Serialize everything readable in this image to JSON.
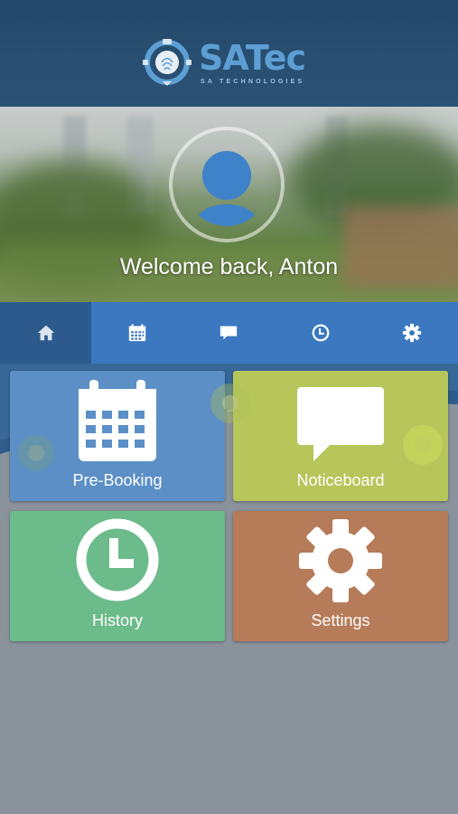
{
  "header": {
    "brand": "SATec",
    "tagline": "SA TECHNOLOGIES",
    "colors": {
      "header_bg": "#24496a",
      "brand_blue": "#5d9fd4"
    }
  },
  "hero": {
    "welcome_text": "Welcome back, Anton",
    "avatar_icon": "user-avatar-icon"
  },
  "tabs": [
    {
      "id": "home",
      "icon": "home-icon",
      "active": true
    },
    {
      "id": "pre-booking",
      "icon": "calendar-icon",
      "active": false
    },
    {
      "id": "noticeboard",
      "icon": "chat-bubble-icon",
      "active": false
    },
    {
      "id": "history",
      "icon": "clock-icon",
      "active": false
    },
    {
      "id": "settings",
      "icon": "gear-icon",
      "active": false
    }
  ],
  "tiles": [
    {
      "label": "Pre-Booking",
      "icon": "calendar-icon",
      "color": "#5b8fc6"
    },
    {
      "label": "Noticeboard",
      "icon": "chat-bubble-icon",
      "color": "#b6c65a"
    },
    {
      "label": "History",
      "icon": "clock-icon",
      "color": "#6cbb8a"
    },
    {
      "label": "Settings",
      "icon": "gear-icon",
      "color": "#b67b58"
    }
  ],
  "colors": {
    "tab_bar": "#3b78c0",
    "tab_active": "#2d5a8c",
    "page_bg": "#8a939c"
  }
}
